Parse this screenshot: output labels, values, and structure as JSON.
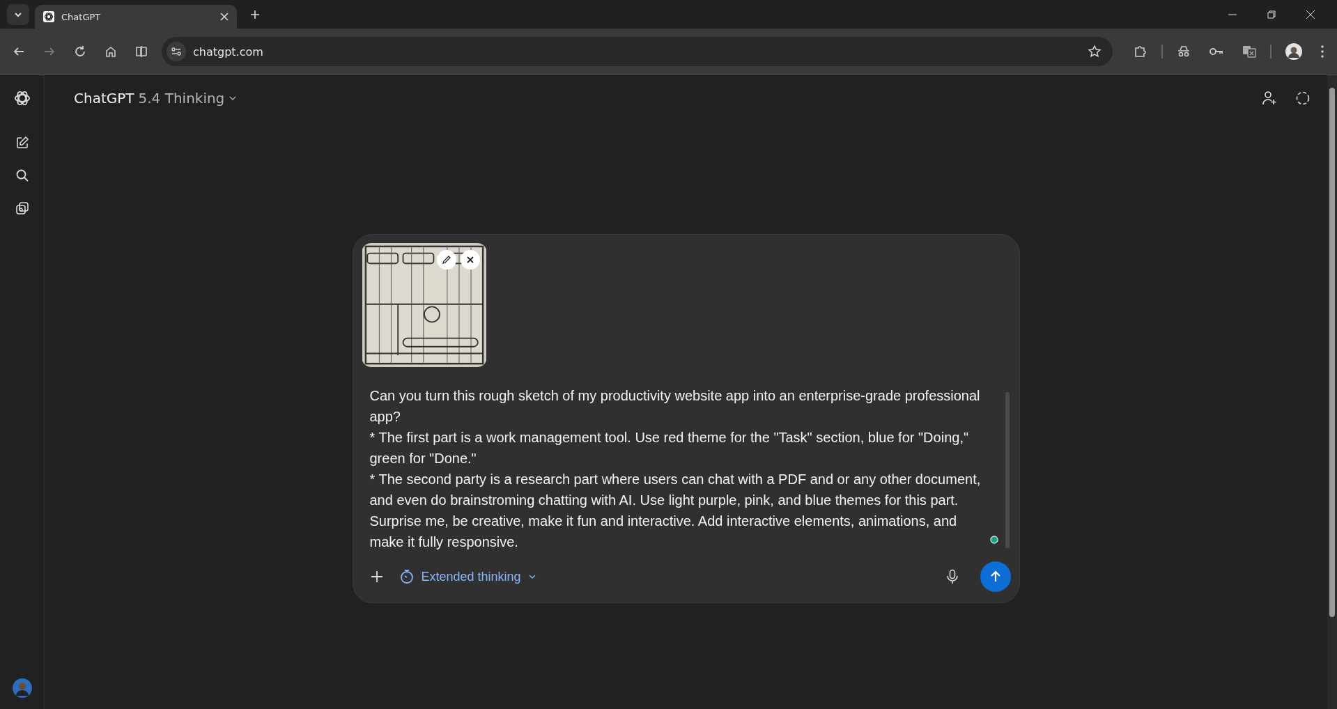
{
  "browser": {
    "tabs": [
      {
        "title": "ChatGPT",
        "selected": true
      }
    ],
    "address": "chatgpt.com"
  },
  "header": {
    "brand": "ChatGPT",
    "model": "5.4 Thinking"
  },
  "composer": {
    "prompt": "Can you turn this rough sketch of my productivity website app into an enterprise-grade professional app?\n* The first part is a work management tool. Use red theme for the \"Task\" section, blue for \"Doing,\" green for \"Done.\"\n* The second party is a research part where users can chat with a PDF and or any other document, and even do brainstroming chatting with AI. Use light purple, pink, and blue themes for this part. Surprise me, be creative, make it fun and interactive. Add interactive elements, animations, and make it fully responsive.",
    "mode": "Extended thinking"
  }
}
